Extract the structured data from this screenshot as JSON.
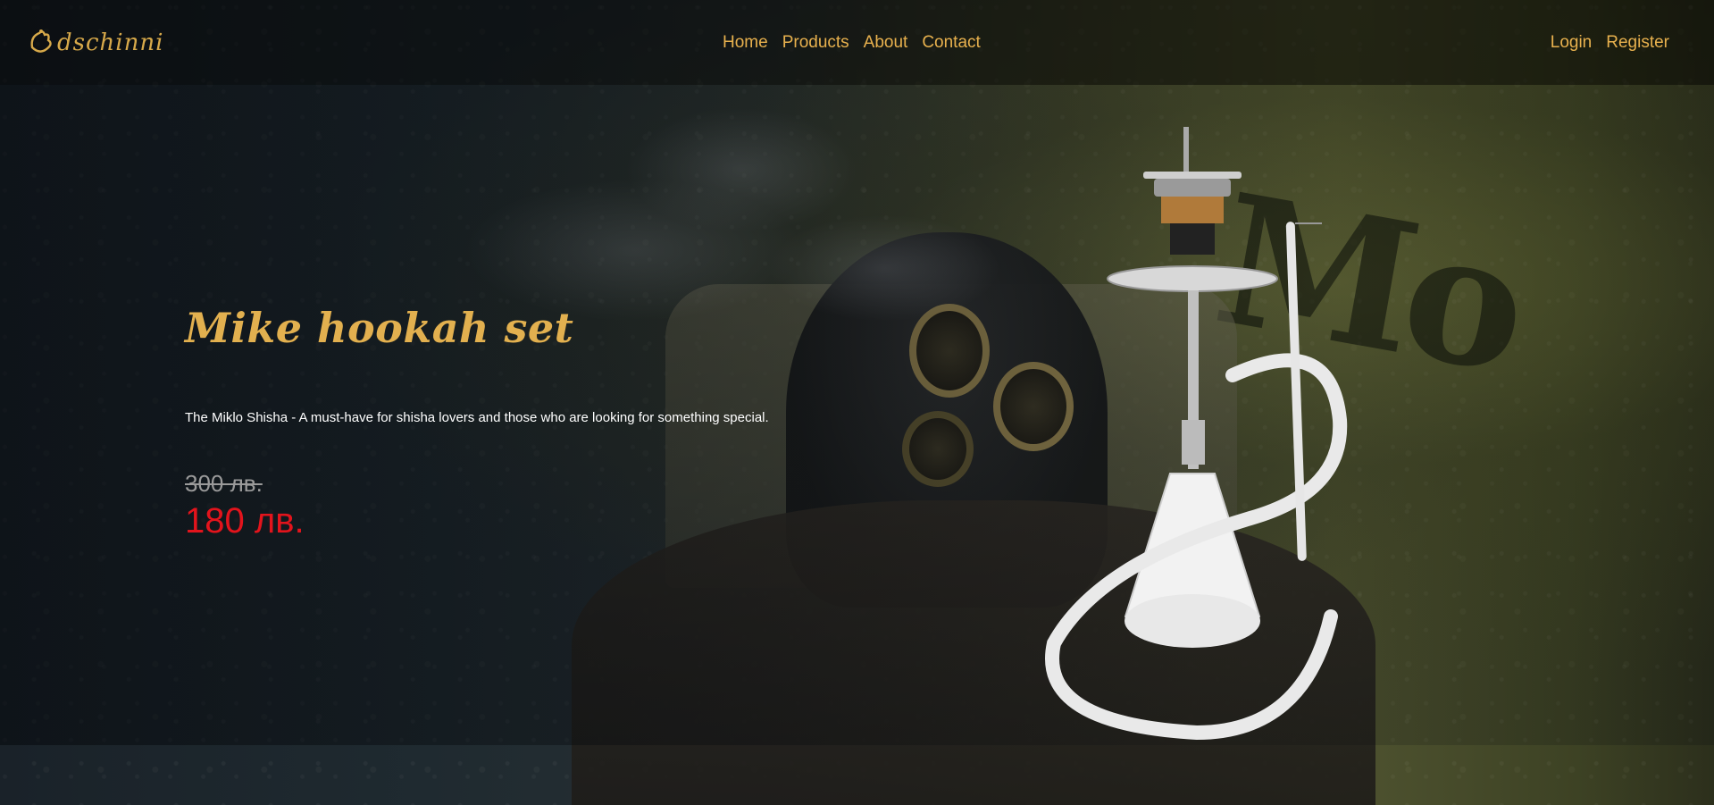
{
  "header": {
    "logo_text": "dschinni",
    "nav": [
      {
        "label": "Home"
      },
      {
        "label": "Products"
      },
      {
        "label": "About"
      },
      {
        "label": "Contact"
      }
    ],
    "auth": {
      "login": "Login",
      "register": "Register"
    }
  },
  "hero": {
    "title": "Mike hookah set",
    "description": "The Miklo Shisha - A must-have for shisha lovers and those who are looking for something special.",
    "old_price": "300 лв.",
    "new_price": "180 лв."
  },
  "colors": {
    "accent": "#e8b14e",
    "price_sale": "#e3141c",
    "price_old": "#9a9a9a"
  }
}
